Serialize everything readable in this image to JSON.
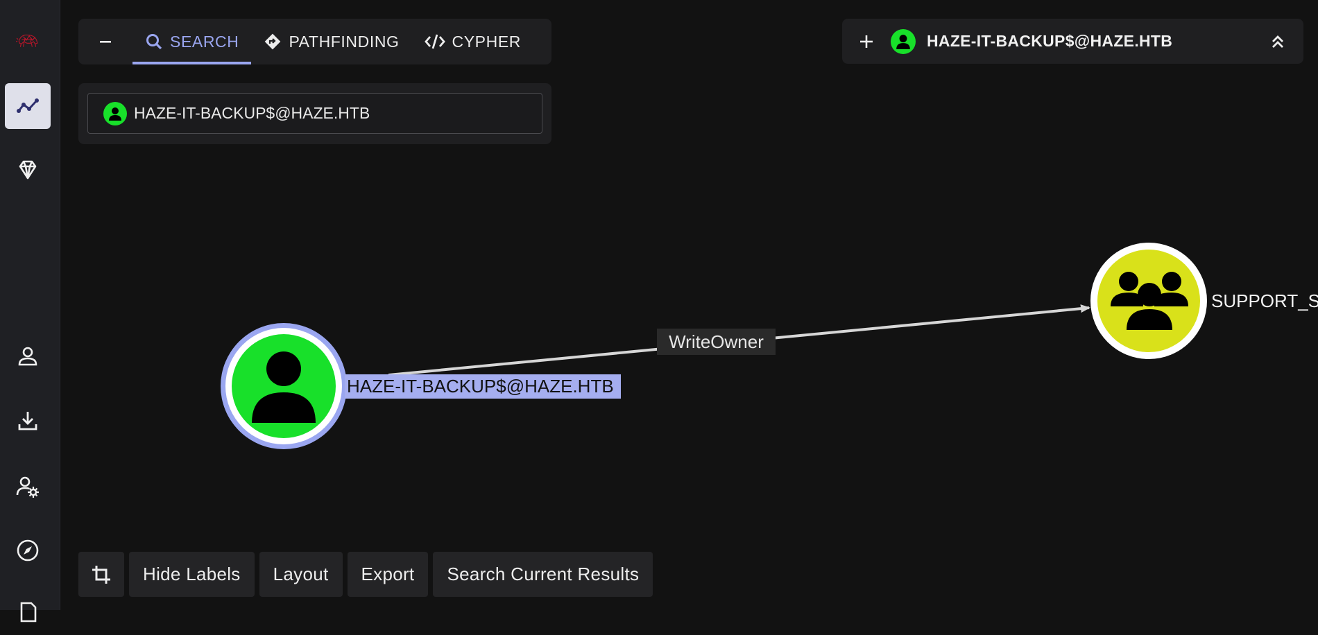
{
  "tabs": {
    "search": "SEARCH",
    "pathfinding": "PATHFINDING",
    "cypher": "CYPHER"
  },
  "search": {
    "value": "HAZE-IT-BACKUP$@HAZE.HTB"
  },
  "selected": {
    "name": "HAZE-IT-BACKUP$@HAZE.HTB"
  },
  "graph": {
    "edge_label": "WriteOwner",
    "source_label": "HAZE-IT-BACKUP$@HAZE.HTB",
    "target_label": "SUPPORT_S"
  },
  "toolbar": {
    "hide_labels": "Hide Labels",
    "layout": "Layout",
    "export": "Export",
    "search_results": "Search Current Results"
  },
  "colors": {
    "accent": "#9aa6f0",
    "user_node": "#18e02a",
    "group_node": "#d9e11a",
    "sidebar_icon": "#2e2f6e"
  }
}
